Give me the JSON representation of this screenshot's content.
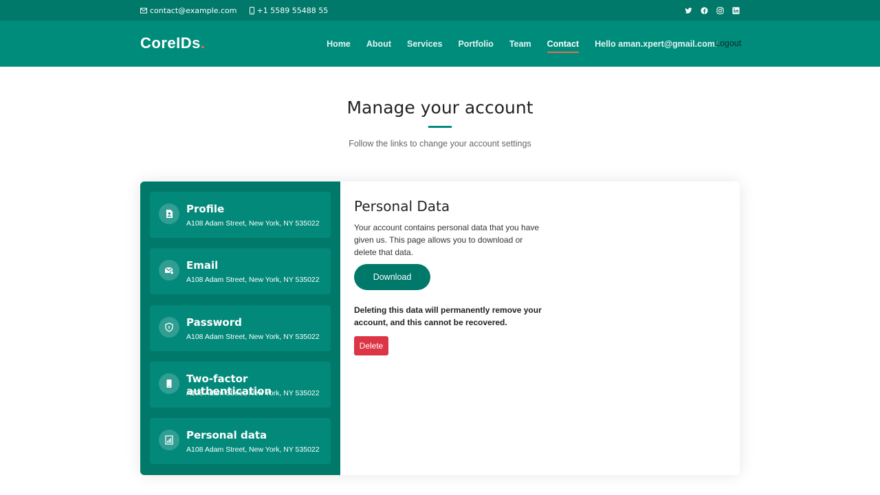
{
  "topbar": {
    "email": "contact@example.com",
    "phone": "+1 5589 55488 55",
    "social": [
      "twitter-icon",
      "facebook-icon",
      "instagram-icon",
      "linkedin-icon"
    ]
  },
  "header": {
    "logo_text": "CoreIDs",
    "logo_dot": ".",
    "nav": [
      "Home",
      "About",
      "Services",
      "Portfolio",
      "Team",
      "Contact",
      "Hello aman.xpert@gmail.com!"
    ],
    "active_nav": "Contact",
    "logout": "Logout"
  },
  "section": {
    "title": "Manage your account",
    "subtitle": "Follow the links to change your account settings"
  },
  "sidebar": {
    "items": [
      {
        "label": "Profile",
        "address": "A108 Adam Street, New York, NY 535022",
        "icon": "profile-icon"
      },
      {
        "label": "Email",
        "address": "A108 Adam Street, New York, NY 535022",
        "icon": "email-icon"
      },
      {
        "label": "Password",
        "address": "A108 Adam Street, New York, NY 535022",
        "icon": "shield-icon"
      },
      {
        "label": "Two-factor authentication",
        "address": "A108 Adam Street, New York, NY 535022",
        "icon": "phone-icon"
      },
      {
        "label": "Personal data",
        "address": "A108 Adam Street, New York, NY 535022",
        "icon": "data-icon"
      }
    ]
  },
  "main": {
    "heading": "Personal Data",
    "description": "Your account contains personal data that you have given us. This page allows you to download or delete that data.",
    "download_label": "Download",
    "warning": "Deleting this data will permanently remove your account, and this cannot be recovered.",
    "delete_label": "Delete"
  },
  "colors": {
    "primary": "#008c7b",
    "primary_dark": "#00786a",
    "accent": "#e96b56",
    "danger": "#dc3545"
  }
}
